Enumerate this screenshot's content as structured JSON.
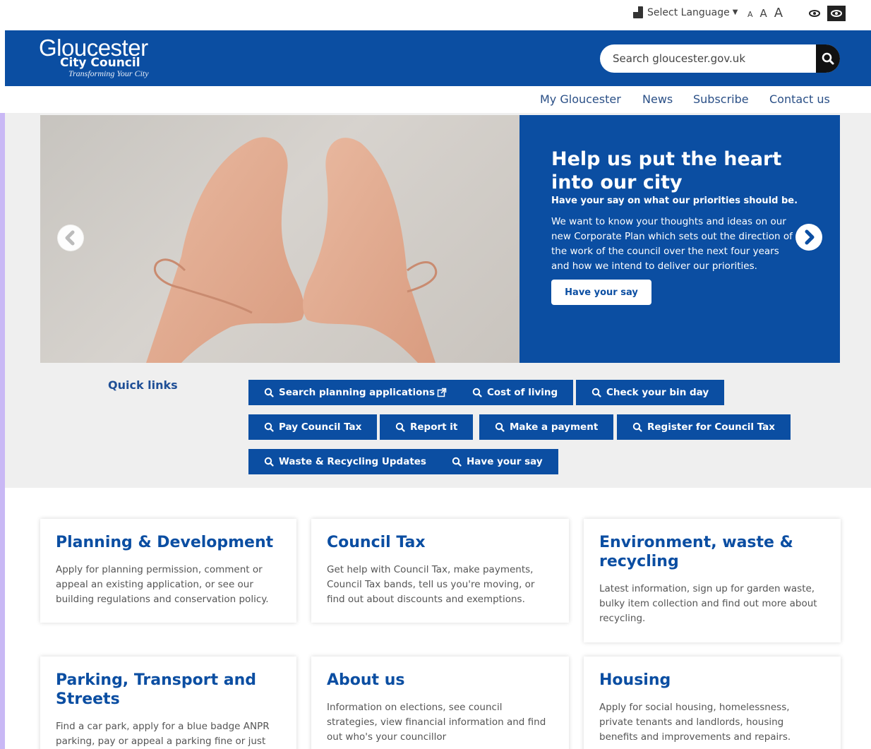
{
  "utility": {
    "language_label": "Select Language",
    "font_small": "A",
    "font_medium": "A",
    "font_large": "A"
  },
  "header": {
    "logo_line1": "Gloucester",
    "logo_line2": "City Council",
    "logo_line3": "Transforming Your City",
    "search_placeholder": "Search gloucester.gov.uk"
  },
  "nav": {
    "items": [
      "My Gloucester",
      "News",
      "Subscribe",
      "Contact us"
    ]
  },
  "hero": {
    "title": "Help us put the heart into our city",
    "subtitle": "Have your say on what our priorities should be.",
    "body": "We want to know your thoughts and ideas on our new Corporate Plan which sets out the direction of the work of the council over the next four years and how we intend to deliver our priorities.",
    "button": "Have your say"
  },
  "quick_links": {
    "label": "Quick links",
    "items": [
      "Search planning applications",
      "Cost of living",
      "Check your bin day",
      "Pay Council Tax",
      "Report it",
      "Make a payment",
      "Register for Council Tax",
      "Waste & Recycling Updates",
      "Have your say"
    ]
  },
  "cards": [
    {
      "title": "Planning & Development",
      "text": "Apply for planning permission, comment or appeal an existing application, or see our building regulations and conservation policy."
    },
    {
      "title": "Council Tax",
      "text": "Get help with Council Tax, make payments, Council Tax bands, tell us you're moving, or find out about discounts and exemptions."
    },
    {
      "title": "Environment, waste & recycling",
      "text": "Latest information, sign up for garden waste, bulky item collection and find out more about recycling."
    },
    {
      "title": "Parking, Transport and Streets",
      "text": "Find a car park, apply for a blue badge ANPR parking, pay or appeal a parking fine or just find"
    },
    {
      "title": "About us",
      "text": "Information on elections, see council strategies, view financial information and find out who's your councillor"
    },
    {
      "title": "Housing",
      "text": "Apply for social housing, homelessness, private tenants and landlords, housing benefits and improvements and repairs."
    }
  ],
  "icons": {
    "language": "language-icon",
    "contrast": "eye-icon",
    "search": "search-icon",
    "prev": "chevron-left-icon",
    "next": "chevron-right-icon",
    "external": "external-link-icon"
  },
  "colors": {
    "brand_blue": "#0b4ea2",
    "link_blue": "#2a4f86",
    "band_gray": "#efefef"
  }
}
